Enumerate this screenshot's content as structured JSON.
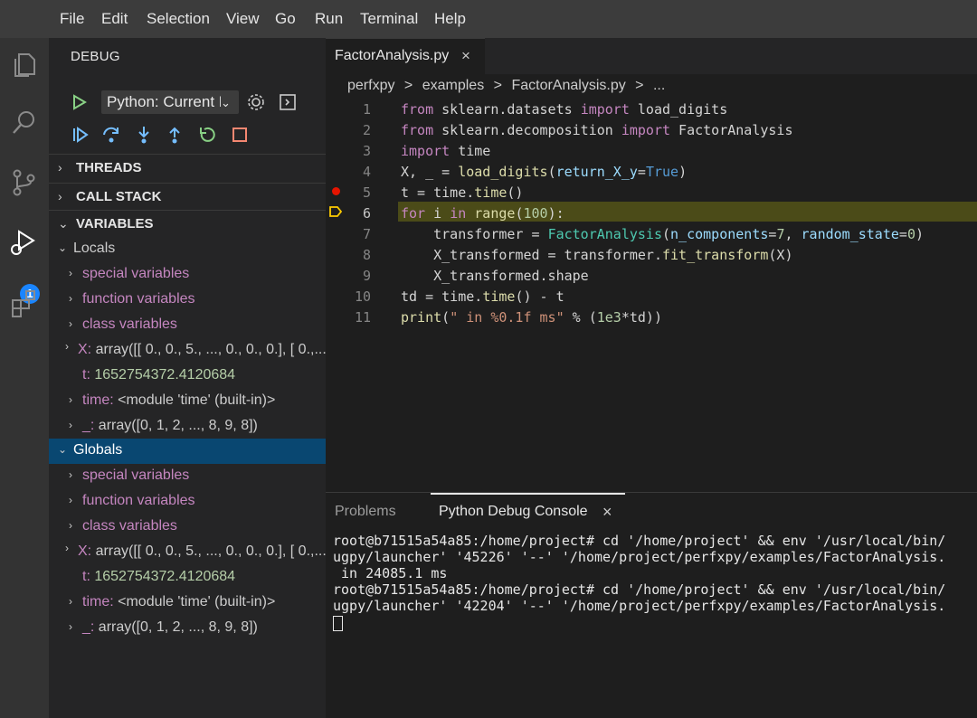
{
  "menu": [
    "File",
    "Edit",
    "Selection",
    "View",
    "Go",
    "Run",
    "Terminal",
    "Help"
  ],
  "activity_bar": {
    "icons": [
      "files-icon",
      "search-icon",
      "source-control-icon",
      "run-debug-icon",
      "extensions-icon"
    ],
    "debug_badge": "1"
  },
  "sidebar": {
    "title": "DEBUG",
    "config_select": "Python: Current File",
    "sections": {
      "threads": "THREADS",
      "call_stack": "CALL STACK",
      "variables": "VARIABLES"
    },
    "locals": {
      "label": "Locals",
      "items": [
        {
          "key": "special variables"
        },
        {
          "key": "function variables"
        },
        {
          "key": "class variables"
        },
        {
          "key": "X:",
          "value": "array([[ 0., 0., 5., ..., 0., 0., 0.], [ 0.,..."
        },
        {
          "key": "t:",
          "value": "1652754372.4120684"
        },
        {
          "key": "time:",
          "value": "<module 'time' (built-in)>"
        },
        {
          "key": "_:",
          "value": "array([0, 1, 2, ..., 8, 9, 8])"
        }
      ]
    },
    "globals": {
      "label": "Globals",
      "items": [
        {
          "key": "special variables"
        },
        {
          "key": "function variables"
        },
        {
          "key": "class variables"
        },
        {
          "key": "X:",
          "value": "array([[ 0., 0., 5., ..., 0., 0., 0.], [ 0.,..."
        },
        {
          "key": "t:",
          "value": "1652754372.4120684"
        },
        {
          "key": "time:",
          "value": "<module 'time' (built-in)>"
        },
        {
          "key": "_:",
          "value": "array([0, 1, 2, ..., 8, 9, 8])"
        }
      ]
    }
  },
  "editor": {
    "tab": "FactorAnalysis.py",
    "breadcrumb": [
      "perfxpy",
      ">",
      "examples",
      ">",
      "FactorAnalysis.py",
      ">",
      "..."
    ],
    "line_numbers": [
      "1",
      "2",
      "3",
      "4",
      "5",
      "6",
      "7",
      "8",
      "9",
      "10",
      "11"
    ],
    "breakpoint_line": "5",
    "current_line": "6",
    "code": [
      "from sklearn.datasets import load_digits",
      "from sklearn.decomposition import FactorAnalysis",
      "import time",
      "X, _ = load_digits(return_X_y=True)",
      "t = time.time()",
      "for i in range(100):",
      "    transformer = FactorAnalysis(n_components=7, random_state=0)",
      "    X_transformed = transformer.fit_transform(X)",
      "    X_transformed.shape",
      "td = time.time() - t",
      "print(\" in %0.1f ms\" % (1e3*td))"
    ]
  },
  "panel": {
    "tabs": [
      "Problems",
      "Python Debug Console"
    ],
    "close": "×",
    "terminal": [
      "root@b71515a54a85:/home/project# cd '/home/project' && env '/usr/local/bin/",
      "ugpy/launcher' '45226' '--' '/home/project/perfxpy/examples/FactorAnalysis.",
      " in 24085.1 ms",
      "root@b71515a54a85:/home/project# cd '/home/project' && env '/usr/local/bin/",
      "ugpy/launcher' '42204' '--' '/home/project/perfxpy/examples/FactorAnalysis."
    ]
  }
}
